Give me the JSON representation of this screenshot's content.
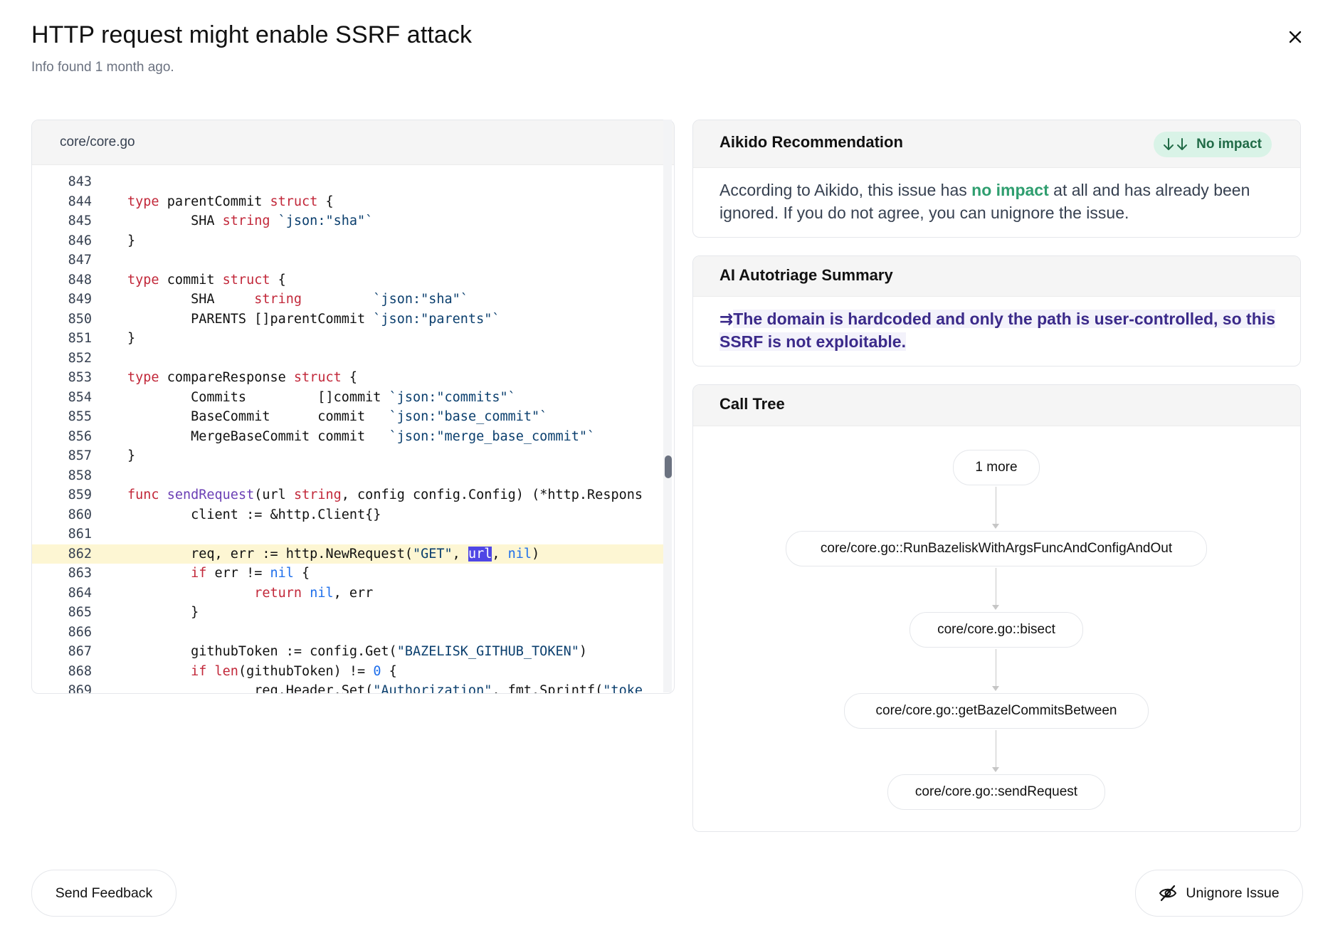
{
  "header": {
    "title": "HTTP request might enable SSRF attack",
    "subtitle": "Info found 1 month ago."
  },
  "code_panel": {
    "file": "core/core.go",
    "highlighted_line": 862,
    "lines": [
      {
        "n": "843",
        "html": ""
      },
      {
        "n": "844",
        "html": "<span class=\"kw\">type</span> parentCommit <span class=\"kw\">struct</span> {"
      },
      {
        "n": "845",
        "html": "        SHA <span class=\"ty\">string</span> <span class=\"str\">`json:\"sha\"`</span>"
      },
      {
        "n": "846",
        "html": "}"
      },
      {
        "n": "847",
        "html": ""
      },
      {
        "n": "848",
        "html": "<span class=\"kw\">type</span> commit <span class=\"kw\">struct</span> {"
      },
      {
        "n": "849",
        "html": "        SHA     <span class=\"ty\">string</span>         <span class=\"str\">`json:\"sha\"`</span>"
      },
      {
        "n": "850",
        "html": "        PARENTS []parentCommit <span class=\"str\">`json:\"parents\"`</span>"
      },
      {
        "n": "851",
        "html": "}"
      },
      {
        "n": "852",
        "html": ""
      },
      {
        "n": "853",
        "html": "<span class=\"kw\">type</span> compareResponse <span class=\"kw\">struct</span> {"
      },
      {
        "n": "854",
        "html": "        Commits         []commit <span class=\"str\">`json:\"commits\"`</span>"
      },
      {
        "n": "855",
        "html": "        BaseCommit      commit   <span class=\"str\">`json:\"base_commit\"`</span>"
      },
      {
        "n": "856",
        "html": "        MergeBaseCommit commit   <span class=\"str\">`json:\"merge_base_commit\"`</span>"
      },
      {
        "n": "857",
        "html": "}"
      },
      {
        "n": "858",
        "html": ""
      },
      {
        "n": "859",
        "html": "<span class=\"kw\">func</span> <span class=\"fn\">sendRequest</span>(url <span class=\"ty\">string</span>, config config.Config) (*http.Respons"
      },
      {
        "n": "860",
        "html": "        client := &amp;http.Client{}"
      },
      {
        "n": "861",
        "html": ""
      },
      {
        "n": "862",
        "html": "        req, err := http.NewRequest(<span class=\"str\">\"GET\"</span>, <span class=\"sel\">url</span>, <span class=\"num\">nil</span>)"
      },
      {
        "n": "863",
        "html": "        <span class=\"kw\">if</span> err != <span class=\"num\">nil</span> {"
      },
      {
        "n": "864",
        "html": "                <span class=\"kw\">return</span> <span class=\"num\">nil</span>, err"
      },
      {
        "n": "865",
        "html": "        }"
      },
      {
        "n": "866",
        "html": ""
      },
      {
        "n": "867",
        "html": "        githubToken := config.Get(<span class=\"str\">\"BAZELISK_GITHUB_TOKEN\"</span>)"
      },
      {
        "n": "868",
        "html": "        <span class=\"kw\">if</span> <span class=\"kw\">len</span>(githubToken) != <span class=\"num\">0</span> {"
      },
      {
        "n": "869",
        "html": "                req.Header.Set(<span class=\"str\">\"Authorization\"</span>, fmt.Sprintf(<span class=\"str\">\"toke</span>"
      }
    ]
  },
  "recommendation": {
    "title": "Aikido Recommendation",
    "badge": "No impact",
    "text_before": "According to Aikido, this issue has ",
    "text_emph": "no impact",
    "text_after": " at all and has already been ignored. If you do not agree, you can unignore the issue."
  },
  "autotriage": {
    "title": "AI Autotriage Summary",
    "text": "The domain is hardcoded and only the path is user-controlled, so this SSRF is not exploitable."
  },
  "call_tree": {
    "title": "Call Tree",
    "nodes": [
      "1 more",
      "core/core.go::RunBazeliskWithArgsFuncAndConfigAndOut",
      "core/core.go::bisect",
      "core/core.go::getBazelCommitsBetween",
      "core/core.go::sendRequest"
    ]
  },
  "footer": {
    "feedback_label": "Send Feedback",
    "unignore_label": "Unignore Issue"
  },
  "colors": {
    "accent_green": "#2f9e6f",
    "badge_bg": "#d9f3e7",
    "ai_text": "#3b2a8a",
    "highlight_line": "#fdf6d3",
    "selection": "#4f46e5"
  }
}
